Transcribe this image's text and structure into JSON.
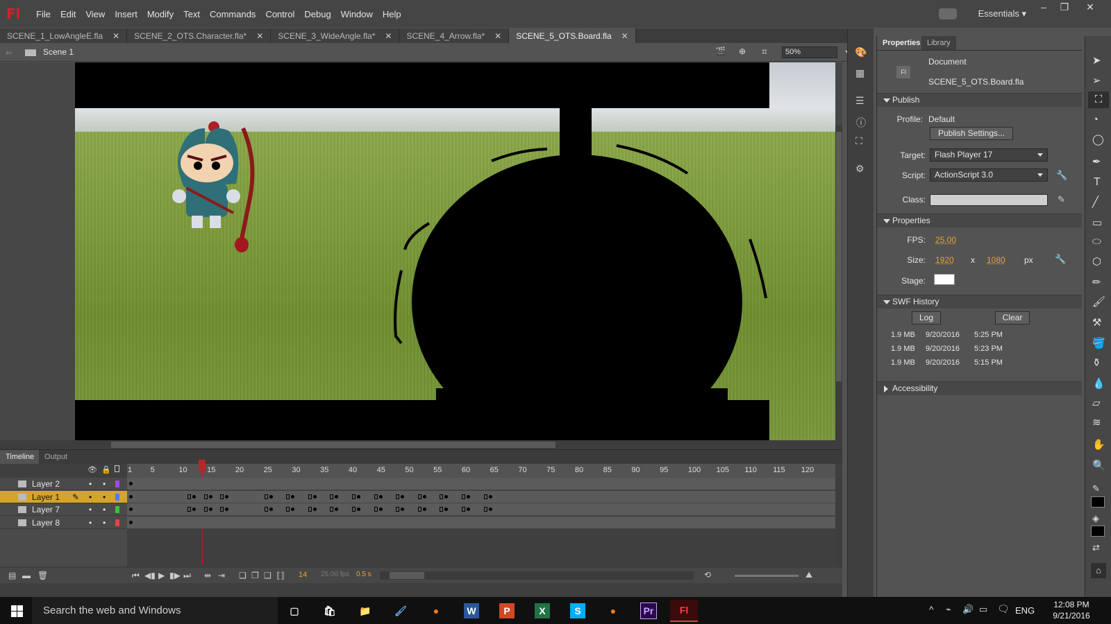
{
  "app": {
    "logo": "Fl"
  },
  "menu": [
    "File",
    "Edit",
    "View",
    "Insert",
    "Modify",
    "Text",
    "Commands",
    "Control",
    "Debug",
    "Window",
    "Help"
  ],
  "workspace": "Essentials",
  "window_controls": {
    "minimize": "–",
    "restore": "❐",
    "close": "✕"
  },
  "document_tabs": [
    {
      "label": "SCENE_1_LowAngleE.fla",
      "active": false
    },
    {
      "label": "SCENE_2_OTS.Character.fla*",
      "active": false
    },
    {
      "label": "SCENE_3_WideAngle.fla*",
      "active": false
    },
    {
      "label": "SCENE_4_Arrow.fla*",
      "active": false
    },
    {
      "label": "SCENE_5_OTS.Board.fla",
      "active": true
    }
  ],
  "edit_bar": {
    "scene": "Scene 1",
    "zoom": "50%"
  },
  "panels": {
    "properties_tab": "Properties",
    "library_tab": "Library"
  },
  "document": {
    "label": "Document",
    "filename": "SCENE_5_OTS.Board.fla"
  },
  "publish": {
    "section": "Publish",
    "profile_label": "Profile:",
    "profile_value": "Default",
    "settings_button": "Publish Settings...",
    "target_label": "Target:",
    "target_value": "Flash Player 17",
    "script_label": "Script:",
    "script_value": "ActionScript 3.0",
    "class_label": "Class:",
    "class_value": ""
  },
  "properties": {
    "section": "Properties",
    "fps_label": "FPS:",
    "fps_value": "25.00",
    "size_label": "Size:",
    "width": "1920",
    "by": "x",
    "height": "1080",
    "unit": "px",
    "stage_label": "Stage:",
    "stage_color": "#ffffff"
  },
  "swf_history": {
    "section": "SWF History",
    "log_button": "Log",
    "clear_button": "Clear",
    "entries": [
      {
        "size": "1.9 MB",
        "date": "9/20/2016",
        "time": "5:25 PM"
      },
      {
        "size": "1.9 MB",
        "date": "9/20/2016",
        "time": "5:23 PM"
      },
      {
        "size": "1.9 MB",
        "date": "9/20/2016",
        "time": "5:15 PM"
      }
    ]
  },
  "accessibility": {
    "section": "Accessibility"
  },
  "timeline": {
    "tabs": [
      "Timeline",
      "Output"
    ],
    "ruler": [
      "1",
      "5",
      "10",
      "15",
      "20",
      "25",
      "30",
      "35",
      "40",
      "45",
      "50",
      "55",
      "60",
      "65",
      "70",
      "75",
      "80",
      "85",
      "90",
      "95",
      "100",
      "105",
      "110",
      "115",
      "120"
    ],
    "layers": [
      {
        "name": "Layer 2",
        "color": "#a04be0",
        "selected": false
      },
      {
        "name": "Layer 1",
        "color": "#4f7df0",
        "selected": true
      },
      {
        "name": "Layer 7",
        "color": "#3fbf3f",
        "selected": false
      },
      {
        "name": "Layer 8",
        "color": "#e04545",
        "selected": false
      }
    ],
    "current_frame": "14",
    "fps_display": "25.00 fps",
    "time_display": "0.5 s"
  },
  "taskbar": {
    "search_placeholder": "Search the web and Windows",
    "apps": [
      {
        "name": "task-view",
        "label": "▢"
      },
      {
        "name": "store",
        "label": "🛍"
      },
      {
        "name": "file-explorer",
        "label": "📁"
      },
      {
        "name": "paint",
        "label": "🖌"
      },
      {
        "name": "firefox",
        "label": "●"
      },
      {
        "name": "word",
        "label": "W"
      },
      {
        "name": "powerpoint",
        "label": "P"
      },
      {
        "name": "excel",
        "label": "X"
      },
      {
        "name": "skype",
        "label": "S"
      },
      {
        "name": "firefox-2",
        "label": "●"
      },
      {
        "name": "premiere",
        "label": "Pr"
      },
      {
        "name": "animate",
        "label": "Fl"
      }
    ],
    "language": "ENG",
    "time": "12:08 PM",
    "date": "9/21/2016"
  }
}
